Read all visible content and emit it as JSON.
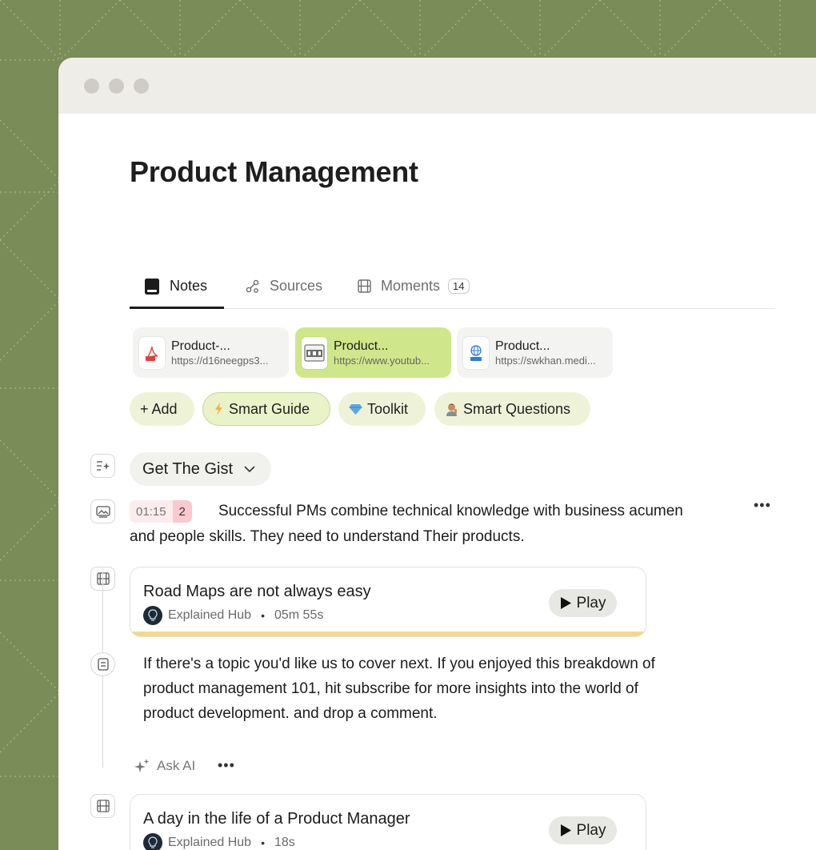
{
  "page": {
    "title": "Product Management"
  },
  "tabs": [
    {
      "label": "Notes"
    },
    {
      "label": "Sources"
    },
    {
      "label": "Moments",
      "count": "14"
    }
  ],
  "sources": [
    {
      "title": "Product-...",
      "url": "https://d16neegps3...",
      "type": "pdf"
    },
    {
      "title": "Product...",
      "url": "https://www.youtub...",
      "type": "video"
    },
    {
      "title": "Product...",
      "url": "https://swkhan.medi...",
      "type": "url"
    }
  ],
  "actions": [
    {
      "label": "+ Add"
    },
    {
      "label": "Smart Guide",
      "icon": "lightning-icon"
    },
    {
      "label": "Toolkit",
      "icon": "diamond-icon"
    },
    {
      "label": "Smart Questions",
      "icon": "person-emoji-icon"
    }
  ],
  "gist": {
    "label": "Get The Gist"
  },
  "summary": {
    "timestamp": "01:15",
    "count": "2",
    "line1": "Successful PMs combine technical knowledge with business acumen",
    "line2": "and people skills. They need to understand Their products."
  },
  "moments": [
    {
      "title": "Road Maps are not always easy",
      "channel": "Explained Hub",
      "duration": "05m 55s",
      "play_label": "Play",
      "accent": "#f5d98a"
    },
    {
      "title": "A day in the life of a Product Manager",
      "channel": "Explained Hub",
      "duration": "18s",
      "play_label": "Play",
      "accent": "#f9c7cf"
    }
  ],
  "note": {
    "lines": [
      "If there's a topic you'd like us to cover next. If you enjoyed this breakdown of",
      "product management 101, hit subscribe for more insights into the world of",
      "product development. and drop a comment."
    ]
  },
  "ask_ai": {
    "label": "Ask AI"
  },
  "colors": {
    "background": "#7a8c58",
    "active_source": "#cfe78a",
    "chip": "#eef3d8"
  }
}
